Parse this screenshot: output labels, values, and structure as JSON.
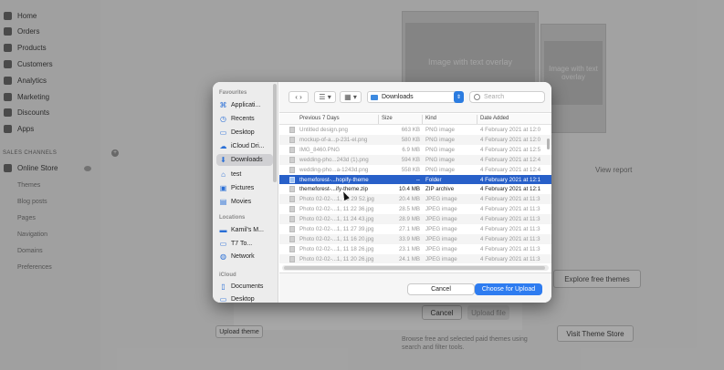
{
  "background": {
    "nav": [
      {
        "label": "Home"
      },
      {
        "label": "Orders"
      },
      {
        "label": "Products"
      },
      {
        "label": "Customers"
      },
      {
        "label": "Analytics"
      },
      {
        "label": "Marketing"
      },
      {
        "label": "Discounts"
      },
      {
        "label": "Apps"
      }
    ],
    "sales_channels_label": "SALES CHANNELS",
    "online_store_label": "Online Store",
    "online_store_sub": [
      "Themes",
      "Blog posts",
      "Pages",
      "Navigation",
      "Domains",
      "Preferences"
    ],
    "theme_card_1_text": "Image with text overlay",
    "theme_card_2_text": "Image with text overlay",
    "view_report": "View report",
    "explore_free_themes": "Explore free themes",
    "upload_dialog_cancel": "Cancel",
    "upload_dialog_upload": "Upload file",
    "upload_theme": "Upload theme",
    "visit_theme_store": "Visit Theme Store",
    "browse_text": "Browse free and selected paid themes using search and filter tools."
  },
  "dialog": {
    "sidebar": {
      "favourites_label": "Favourites",
      "favourites": [
        {
          "label": "Applicati...",
          "icon": "applications-icon"
        },
        {
          "label": "Recents",
          "icon": "clock-icon"
        },
        {
          "label": "Desktop",
          "icon": "desktop-icon"
        },
        {
          "label": "iCloud Dri...",
          "icon": "cloud-icon"
        },
        {
          "label": "Downloads",
          "icon": "download-icon"
        },
        {
          "label": "test",
          "icon": "home-icon"
        },
        {
          "label": "Pictures",
          "icon": "pictures-icon"
        },
        {
          "label": "Movies",
          "icon": "movies-icon"
        }
      ],
      "locations_label": "Locations",
      "locations": [
        {
          "label": "Kamil's M...",
          "icon": "laptop-icon"
        },
        {
          "label": "T7 To...",
          "icon": "drive-icon"
        },
        {
          "label": "Network",
          "icon": "network-icon"
        }
      ],
      "icloud_label": "iCloud",
      "icloud": [
        {
          "label": "Documents",
          "icon": "document-icon"
        },
        {
          "label": "Desktop",
          "icon": "desktop-icon"
        }
      ]
    },
    "toolbar": {
      "location": "Downloads",
      "search_placeholder": "Search"
    },
    "columns": {
      "name": "Previous 7 Days",
      "size": "Size",
      "kind": "Kind",
      "date": "Date Added"
    },
    "files": [
      {
        "name": "Untitled design.png",
        "size": "663 KB",
        "kind": "PNG image",
        "date": "4 February 2021 at 12:0"
      },
      {
        "name": "mockup-of-a...p-231-el.png",
        "size": "580 KB",
        "kind": "PNG image",
        "date": "4 February 2021 at 12:0"
      },
      {
        "name": "IMG_8460.PNG",
        "size": "6.9 MB",
        "kind": "PNG image",
        "date": "4 February 2021 at 12:5"
      },
      {
        "name": "wedding-pho...243d (1).png",
        "size": "594 KB",
        "kind": "PNG image",
        "date": "4 February 2021 at 12:4"
      },
      {
        "name": "wedding-pho...a-1243d.png",
        "size": "558 KB",
        "kind": "PNG image",
        "date": "4 February 2021 at 12:4"
      },
      {
        "name": "themeforest-...hopify-theme",
        "size": "--",
        "kind": "Folder",
        "date": "4 February 2021 at 12:1"
      },
      {
        "name": "themeforest-...ify-theme.zip",
        "size": "10.4 MB",
        "kind": "ZIP archive",
        "date": "4 February 2021 at 12:1"
      },
      {
        "name": "Photo 02-02-...1, 18 29 52.jpg",
        "size": "20.4 MB",
        "kind": "JPEG image",
        "date": "4 February 2021 at 11:3"
      },
      {
        "name": "Photo 02-02-...1, 11 22 36.jpg",
        "size": "28.5 MB",
        "kind": "JPEG image",
        "date": "4 February 2021 at 11:3"
      },
      {
        "name": "Photo 02-02-...1, 11 24 43.jpg",
        "size": "28.9 MB",
        "kind": "JPEG image",
        "date": "4 February 2021 at 11:3"
      },
      {
        "name": "Photo 02-02-...1, 11 27 39.jpg",
        "size": "27.1 MB",
        "kind": "JPEG image",
        "date": "4 February 2021 at 11:3"
      },
      {
        "name": "Photo 02-02-...1, 11 16 20.jpg",
        "size": "33.9 MB",
        "kind": "JPEG image",
        "date": "4 February 2021 at 11:3"
      },
      {
        "name": "Photo 02-02-...1, 11 18 26.jpg",
        "size": "23.1 MB",
        "kind": "JPEG image",
        "date": "4 February 2021 at 11:3"
      },
      {
        "name": "Photo 02-02-...1, 11 20 26.jpg",
        "size": "24.1 MB",
        "kind": "JPEG image",
        "date": "4 February 2021 at 11:3"
      }
    ],
    "enabled_rows": [
      5,
      6
    ],
    "selected_row": 5,
    "buttons": {
      "cancel": "Cancel",
      "choose": "Choose for Upload"
    }
  }
}
